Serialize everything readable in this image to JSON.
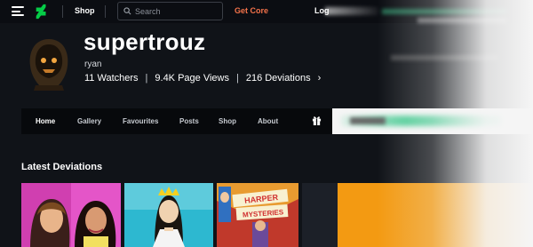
{
  "topbar": {
    "shop_label": "Shop",
    "search_placeholder": "Search",
    "get_core_label": "Get Core",
    "login_label": "Log"
  },
  "profile": {
    "username": "supertrouz",
    "real_name": "ryan",
    "watchers": "11 Watchers",
    "page_views": "9.4K Page Views",
    "deviations": "216 Deviations",
    "separator": "|",
    "chevron": "›"
  },
  "tabs": [
    {
      "label": "Home"
    },
    {
      "label": "Gallery"
    },
    {
      "label": "Favourites"
    },
    {
      "label": "Posts"
    },
    {
      "label": "Shop"
    },
    {
      "label": "About"
    }
  ],
  "latest": {
    "title": "Latest Deviations",
    "thumb_text": "HARPER\nMYSTERIES"
  },
  "colors": {
    "accent_orange": "#f3724a",
    "brand_green": "#05cc47"
  }
}
